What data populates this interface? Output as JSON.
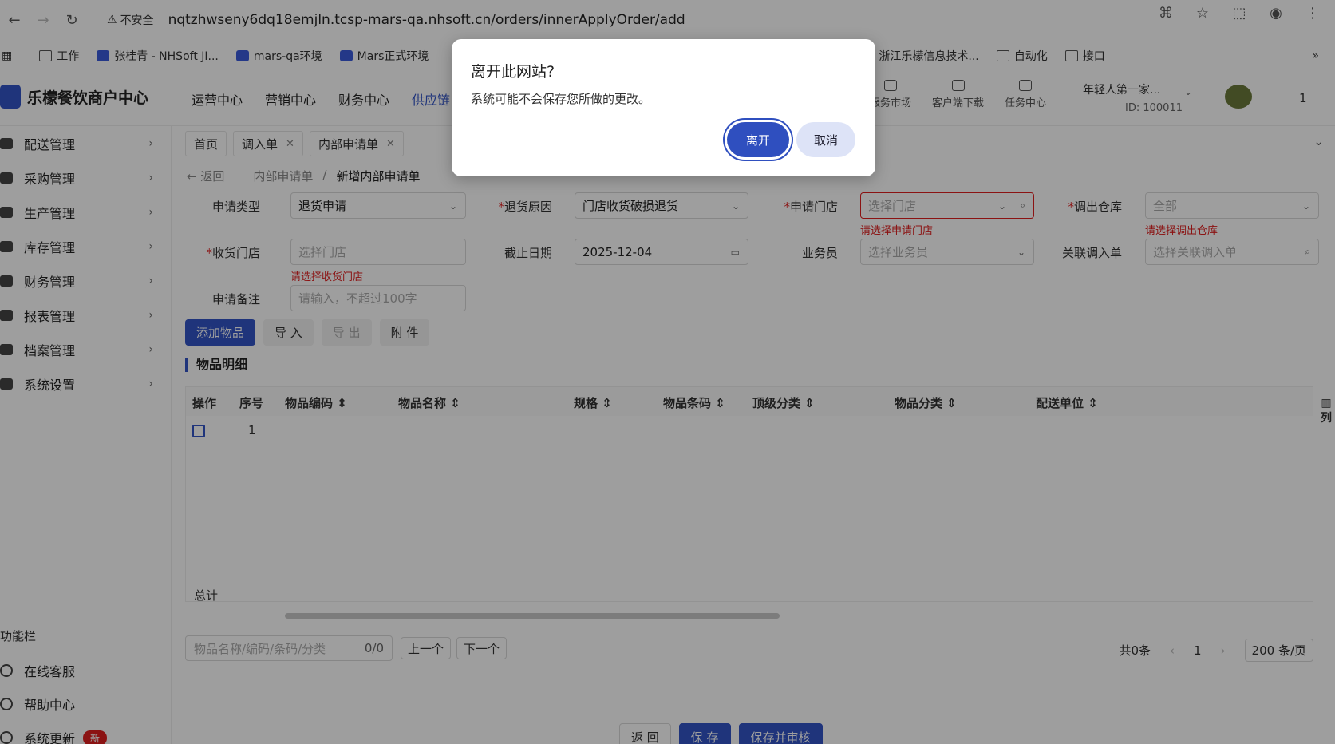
{
  "browser": {
    "insecure_label": "不安全",
    "url": "nqtzhwseny6dq18emjln.tcsp-mars-qa.nhsoft.cn/orders/innerApplyOrder/add",
    "bookmarks": [
      {
        "label": "工作"
      },
      {
        "label": "张桂青 - NHSoft JI..."
      },
      {
        "label": "mars-qa环境"
      },
      {
        "label": "Mars正式环境"
      },
      {
        "label": "浙江乐檬信息技术..."
      },
      {
        "label": "自动化"
      },
      {
        "label": "接口"
      }
    ]
  },
  "app": {
    "logo_text": "乐檬餐饮商户中心",
    "topnav": [
      "运营中心",
      "营销中心",
      "财务中心",
      "供应链"
    ],
    "tools": [
      "服务市场",
      "客户端下载",
      "任务中心"
    ],
    "user_name": "年轻人第一家...",
    "user_id": "ID: 100011",
    "user_num": "1"
  },
  "sidebar": {
    "items": [
      {
        "label": "配送管理"
      },
      {
        "label": "采购管理"
      },
      {
        "label": "生产管理"
      },
      {
        "label": "库存管理"
      },
      {
        "label": "财务管理"
      },
      {
        "label": "报表管理"
      },
      {
        "label": "档案管理"
      },
      {
        "label": "系统设置"
      }
    ],
    "func_title": "功能栏",
    "func_items": [
      {
        "label": "在线客服"
      },
      {
        "label": "帮助中心"
      },
      {
        "label": "系统更新"
      }
    ],
    "new_badge": "新"
  },
  "main": {
    "tabs": [
      "首页",
      "调入单",
      "内部申请单"
    ],
    "back_label": "返回",
    "crumb_parent": "内部申请单",
    "crumb_sep": "/",
    "crumb_current": "新增内部申请单",
    "form": {
      "apply_type_label": "申请类型",
      "apply_type_value": "退货申请",
      "reason_label": "退货原因",
      "reason_value": "门店收货破损退货",
      "store_label": "申请门店",
      "store_placeholder": "选择门店",
      "store_error": "请选择申请门店",
      "warehouse_label": "调出仓库",
      "warehouse_placeholder": "全部",
      "warehouse_error": "请选择调出仓库",
      "recv_store_label": "收货门店",
      "recv_store_placeholder": "选择门店",
      "recv_store_error": "请选择收货门店",
      "deadline_label": "截止日期",
      "deadline_value": "2025-12-04",
      "salesman_label": "业务员",
      "salesman_placeholder": "选择业务员",
      "linked_label": "关联调入单",
      "linked_placeholder": "选择关联调入单",
      "remark_label": "申请备注",
      "remark_placeholder": "请输入，不超过100字"
    },
    "buttons": [
      "添加物品",
      "导 入",
      "导 出",
      "附 件"
    ],
    "section_title": "物品明细",
    "columns": [
      "操作",
      "序号",
      "物品编码",
      "物品名称",
      "规格",
      "物品条码",
      "顶级分类",
      "物品分类",
      "配送单位"
    ],
    "col_ctrl": "列",
    "rows": [
      {
        "num": "1"
      }
    ],
    "total_label": "总计",
    "search_placeholder": "物品名称/编码/条码/分类",
    "search_count": "0/0",
    "prev_label": "上一个",
    "next_label": "下一个",
    "pager_total": "共0条",
    "pager_page": "1",
    "pager_size": "200 条/页",
    "footer_buttons": [
      "返 回",
      "保 存",
      "保存并审核"
    ]
  },
  "dialog": {
    "title": "离开此网站?",
    "message": "系统可能不会保存您所做的更改。",
    "leave_label": "离开",
    "cancel_label": "取消"
  }
}
